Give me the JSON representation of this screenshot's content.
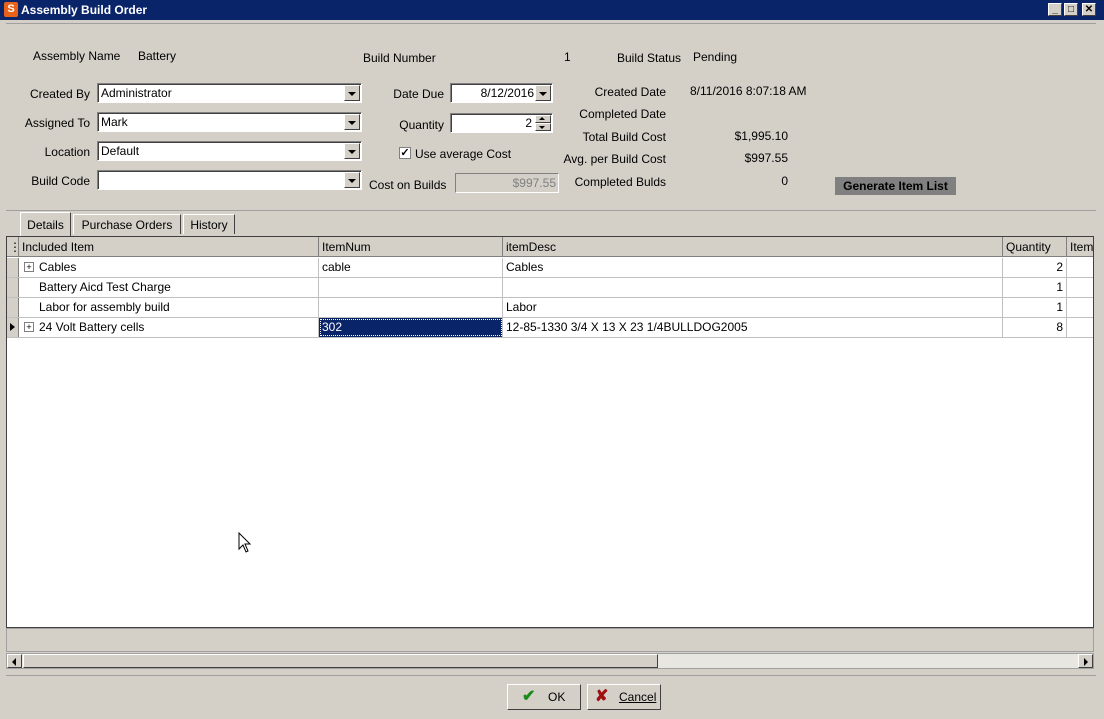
{
  "window": {
    "title": "Assembly Build Order",
    "app_icon": "S"
  },
  "header": {
    "assembly_name_label": "Assembly Name",
    "assembly_name": "Battery",
    "build_number_label": "Build Number",
    "build_number": "1",
    "build_status_label": "Build Status",
    "build_status": "Pending",
    "created_by_label": "Created By",
    "created_by": "Administrator",
    "assigned_to_label": "Assigned To",
    "assigned_to": "Mark",
    "location_label": "Location",
    "location": "Default",
    "build_code_label": "Build Code",
    "build_code": "",
    "date_due_label": "Date Due",
    "date_due": "8/12/2016",
    "quantity_label": "Quantity",
    "quantity": "2",
    "use_avg_cost_label": "Use average Cost",
    "use_avg_cost_checked": true,
    "cost_on_builds_label": "Cost on Builds",
    "cost_on_builds": "$997.55",
    "created_date_label": "Created Date",
    "created_date": "8/11/2016 8:07:18 AM",
    "completed_date_label": "Completed Date",
    "completed_date": "",
    "total_build_cost_label": "Total Build Cost",
    "total_build_cost": "$1,995.10",
    "avg_per_build_cost_label": "Avg. per Build Cost",
    "avg_per_build_cost": "$997.55",
    "completed_builds_label": "Completed Bulds",
    "completed_builds": "0",
    "generate_button": "Generate Item List"
  },
  "tabs": [
    {
      "label": "Details",
      "active": true
    },
    {
      "label": "Purchase Orders",
      "active": false
    },
    {
      "label": "History",
      "active": false
    }
  ],
  "grid": {
    "columns": [
      "Included Item",
      "ItemNum",
      "itemDesc",
      "Quantity",
      "Item"
    ],
    "rows": [
      {
        "item": "Cables",
        "itemnum": "cable",
        "desc": "Cables",
        "qty": "2",
        "expandable": true,
        "current": false
      },
      {
        "item": "Battery Aicd Test Charge",
        "itemnum": "",
        "desc": "",
        "qty": "1",
        "expandable": false,
        "current": false
      },
      {
        "item": "Labor for assembly build",
        "itemnum": "",
        "desc": "Labor",
        "qty": "1",
        "expandable": false,
        "current": false
      },
      {
        "item": "24 Volt Battery cells",
        "itemnum": "302",
        "desc": "12-85-1330 3/4 X 13 X 23 1/4BULLDOG2005",
        "qty": "8",
        "expandable": true,
        "current": true
      }
    ]
  },
  "footer": {
    "ok_label": "OK",
    "cancel_label": "Cancel"
  },
  "colors": {
    "titlebar": "#0a246a",
    "selection": "#0a246a",
    "face": "#d4d0c8"
  }
}
